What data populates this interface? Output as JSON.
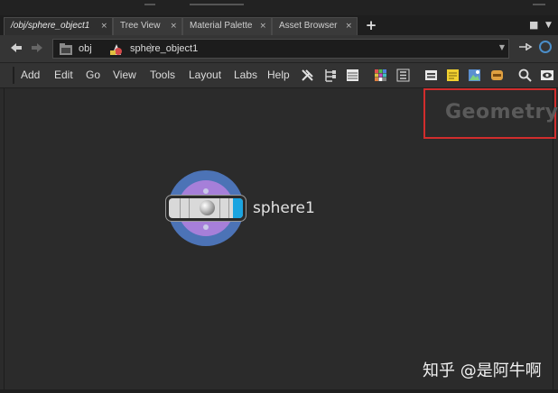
{
  "tabs": [
    {
      "label": "/obj/sphere_object1",
      "close": "×",
      "active": true
    },
    {
      "label": "Tree View",
      "close": "×",
      "active": false
    },
    {
      "label": "Material Palette",
      "close": "×",
      "active": false
    },
    {
      "label": "Asset Browser",
      "close": "×",
      "active": false
    }
  ],
  "new_tab_label": "+",
  "window_controls": {
    "maximize": "■",
    "menu": "▼"
  },
  "path": {
    "segments": [
      {
        "label": "obj",
        "icon": "network-folder-icon"
      },
      {
        "label": "sphere_object1",
        "icon": "geometry-object-icon"
      }
    ]
  },
  "menubar": {
    "items": [
      "Add",
      "Edit",
      "Go",
      "View",
      "Tools",
      "Layout",
      "Labs",
      "Help"
    ]
  },
  "network": {
    "context_label": "Geometry",
    "node": {
      "name": "sphere1"
    }
  },
  "watermark": "知乎 @是阿牛啊",
  "colors": {
    "accent_blue": "#1aa4e0",
    "node_ring_outer": "#4c73b6",
    "node_ring_inner": "#a67fd9",
    "highlight_box": "#d12d2d"
  }
}
